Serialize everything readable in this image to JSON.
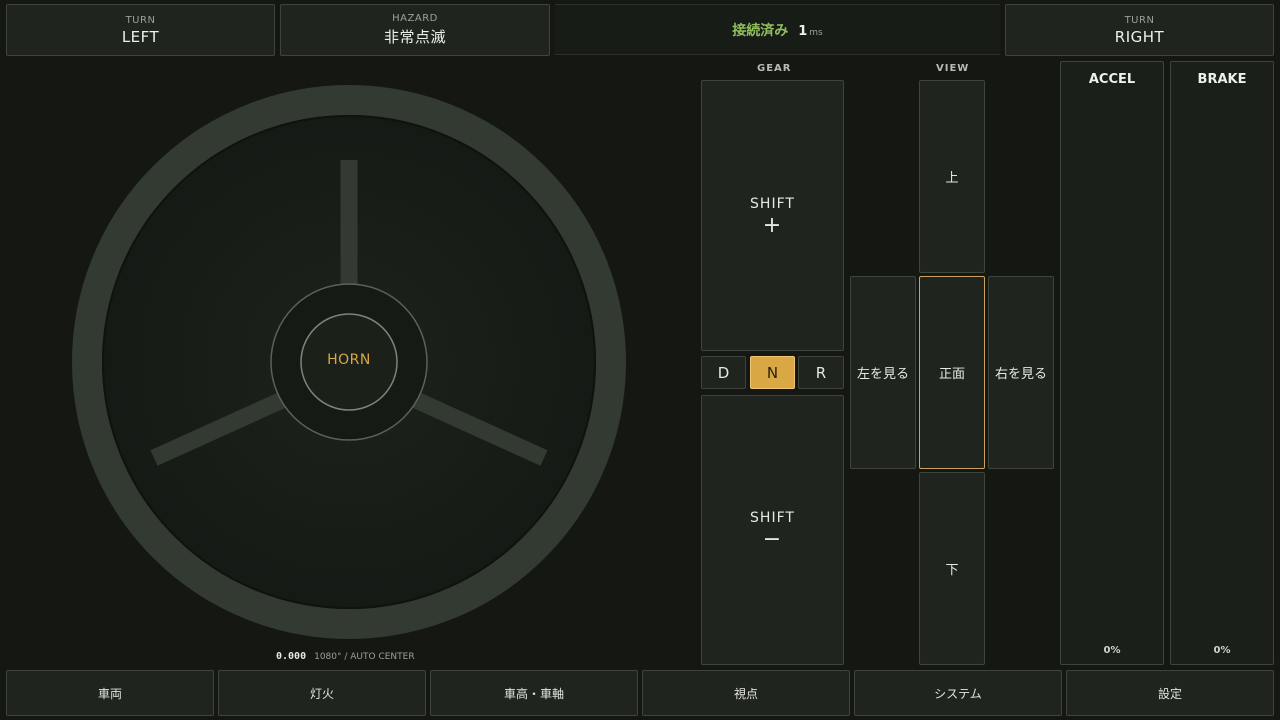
{
  "top": {
    "turn_left": {
      "small": "TURN",
      "big": "LEFT"
    },
    "hazard": {
      "small": "HAZARD",
      "big": "非常点滅"
    },
    "status": {
      "connection": "接続済み",
      "latency": "1",
      "latency_unit": "ms"
    },
    "turn_right": {
      "small": "TURN",
      "big": "RIGHT"
    }
  },
  "wheel": {
    "horn_label": "HORN",
    "angle_value": "0.000",
    "range_info": "1080° / AUTO CENTER"
  },
  "gear": {
    "section_label": "GEAR",
    "shift_up": {
      "label": "SHIFT",
      "symbol": "+"
    },
    "shift_down": {
      "label": "SHIFT",
      "symbol": "−"
    },
    "selectors": [
      "D",
      "N",
      "R"
    ],
    "active_selector": "N"
  },
  "view": {
    "section_label": "VIEW",
    "up": "上",
    "left": "左を見る",
    "front": "正面",
    "right": "右を見る",
    "down": "下",
    "active": "front"
  },
  "pedals": {
    "accel": {
      "label": "ACCEL",
      "value": "0%"
    },
    "brake": {
      "label": "BRAKE",
      "value": "0%"
    }
  },
  "bottom_tabs": [
    "車両",
    "灯火",
    "車高・車軸",
    "視点",
    "システム",
    "設定"
  ],
  "colors": {
    "accent": "#d9a744",
    "connected": "#8fbf5e",
    "background": "#141712"
  }
}
